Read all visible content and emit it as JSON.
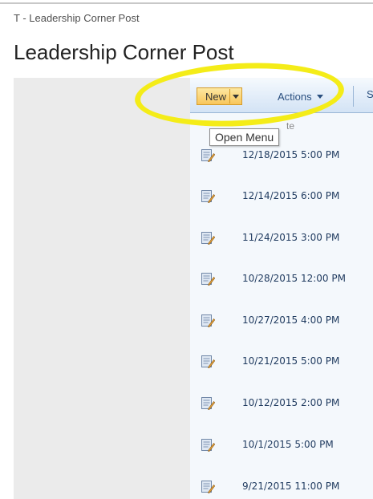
{
  "breadcrumb": "T - Leadership Corner Post",
  "page_title": "Leadership Corner Post",
  "toolbar": {
    "new_label": "New",
    "actions_label": "Actions",
    "settings_label": "S"
  },
  "tooltip": "Open Menu",
  "column_header": "te",
  "highlight_color": "#f4ec18",
  "toolbar_accent": "#f8c65b",
  "rows": [
    {
      "date": "12/18/2015 5:00 PM",
      "icon": "edit-document-icon"
    },
    {
      "date": "12/14/2015 6:00 PM",
      "icon": "edit-document-icon"
    },
    {
      "date": "11/24/2015 3:00 PM",
      "icon": "edit-document-icon"
    },
    {
      "date": "10/28/2015 12:00 PM",
      "icon": "edit-document-icon"
    },
    {
      "date": "10/27/2015 4:00 PM",
      "icon": "edit-document-icon"
    },
    {
      "date": "10/21/2015 5:00 PM",
      "icon": "edit-document-icon"
    },
    {
      "date": "10/12/2015 2:00 PM",
      "icon": "edit-document-icon"
    },
    {
      "date": "10/1/2015 5:00 PM",
      "icon": "edit-document-icon"
    },
    {
      "date": "9/21/2015 11:00 PM",
      "icon": "edit-document-icon"
    }
  ]
}
